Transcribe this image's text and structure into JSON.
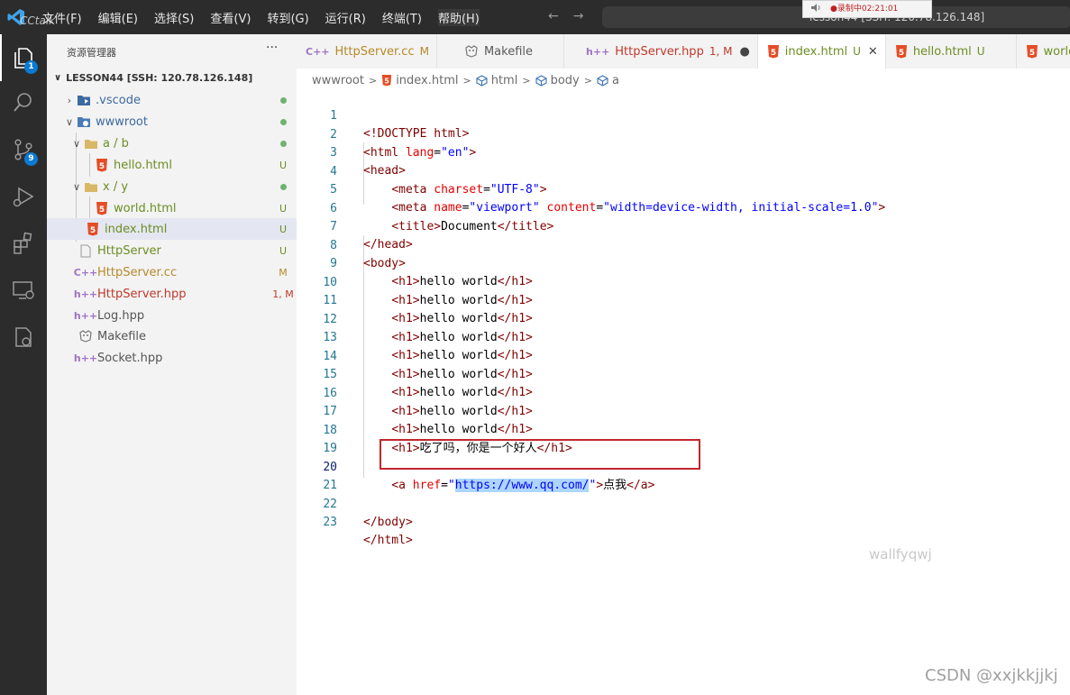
{
  "window": {
    "overlay_text": "CCtalk",
    "menu": [
      "文件(F)",
      "编辑(E)",
      "选择(S)",
      "查看(V)",
      "转到(G)",
      "运行(R)",
      "终端(T)",
      "帮助(H)"
    ],
    "search_text": "lesson44 [SSH: 120.78.126.148]",
    "recording_text": "●录制中02:21:01"
  },
  "activity_bar": {
    "explorer_badge": "1",
    "scm_badge": "9"
  },
  "sidebar": {
    "title": "资源管理器",
    "more": "···",
    "root": "LESSON44 [SSH: 120.78.126.148]",
    "items": [
      {
        "label": ".vscode",
        "badge": "",
        "dot": true,
        "color": "#3b6aa0"
      },
      {
        "label": "wwwroot",
        "badge": "",
        "dot": true,
        "color": "#3b6aa0"
      },
      {
        "label": "a / b",
        "badge": "",
        "dot": true,
        "color": "#6b8e23"
      },
      {
        "label": "hello.html",
        "badge": "U",
        "dot": false,
        "color": "#6b8e23"
      },
      {
        "label": "x / y",
        "badge": "",
        "dot": true,
        "color": "#6b8e23"
      },
      {
        "label": "world.html",
        "badge": "U",
        "dot": false,
        "color": "#6b8e23"
      },
      {
        "label": "index.html",
        "badge": "U",
        "dot": false,
        "color": "#6b8e23"
      },
      {
        "label": "HttpServer",
        "badge": "U",
        "dot": false,
        "color": "#6b8e23"
      },
      {
        "label": "HttpServer.cc",
        "badge": "M",
        "dot": false,
        "color": "#b58a2a"
      },
      {
        "label": "HttpServer.hpp",
        "badge": "1, M",
        "dot": false,
        "color": "#c0392b"
      },
      {
        "label": "Log.hpp",
        "badge": "",
        "dot": false,
        "color": "#555555"
      },
      {
        "label": "Makefile",
        "badge": "",
        "dot": false,
        "color": "#555555"
      },
      {
        "label": "Socket.hpp",
        "badge": "",
        "dot": false,
        "color": "#555555"
      }
    ]
  },
  "tabs": [
    {
      "label": "HttpServer.cc",
      "status": "M"
    },
    {
      "label": "Makefile",
      "status": ""
    },
    {
      "label": "HttpServer.hpp",
      "status": "1, M"
    },
    {
      "label": "index.html",
      "status": "U"
    },
    {
      "label": "hello.html",
      "status": "U"
    },
    {
      "label": "world.htm",
      "status": ""
    }
  ],
  "breadcrumb": [
    "wwwroot",
    "index.html",
    "html",
    "body",
    "a"
  ],
  "code": {
    "line_numbers": [
      "1",
      "2",
      "3",
      "4",
      "5",
      "6",
      "7",
      "8",
      "9",
      "10",
      "11",
      "12",
      "13",
      "14",
      "15",
      "16",
      "17",
      "18",
      "19",
      "20",
      "21",
      "22",
      "23"
    ],
    "doctype": "<!DOCTYPE html>",
    "html_open": "<html",
    "lang_attr": " lang",
    "lang_value": "\"en\"",
    "head_open": "<head>",
    "meta": "<meta",
    "charset_attr": " charset",
    "charset_value": "\"UTF-8\"",
    "name_attr": " name",
    "name_value": "\"viewport\"",
    "content_attr": " content",
    "content_value": "\"width=device-width, initial-scale=1.0\"",
    "title_open": "<title>",
    "title_text": "Document",
    "title_close": "</title>",
    "head_close": "</head>",
    "body_open": "<body>",
    "h1_open": "<h1>",
    "h1_text": "hello world",
    "h1_close": "</h1>",
    "h1_last_text": "吃了吗，你是一个好人",
    "a_open": "<a",
    "href_attr": " href",
    "href_value": "https://www.qq.com/",
    "a_text": "点我",
    "a_close": "</a>",
    "body_close": "</body>",
    "html_close": "</html>"
  },
  "watermarks": {
    "name": "wallfyqwj",
    "csdn": "CSDN @xxjkkjjkj"
  }
}
